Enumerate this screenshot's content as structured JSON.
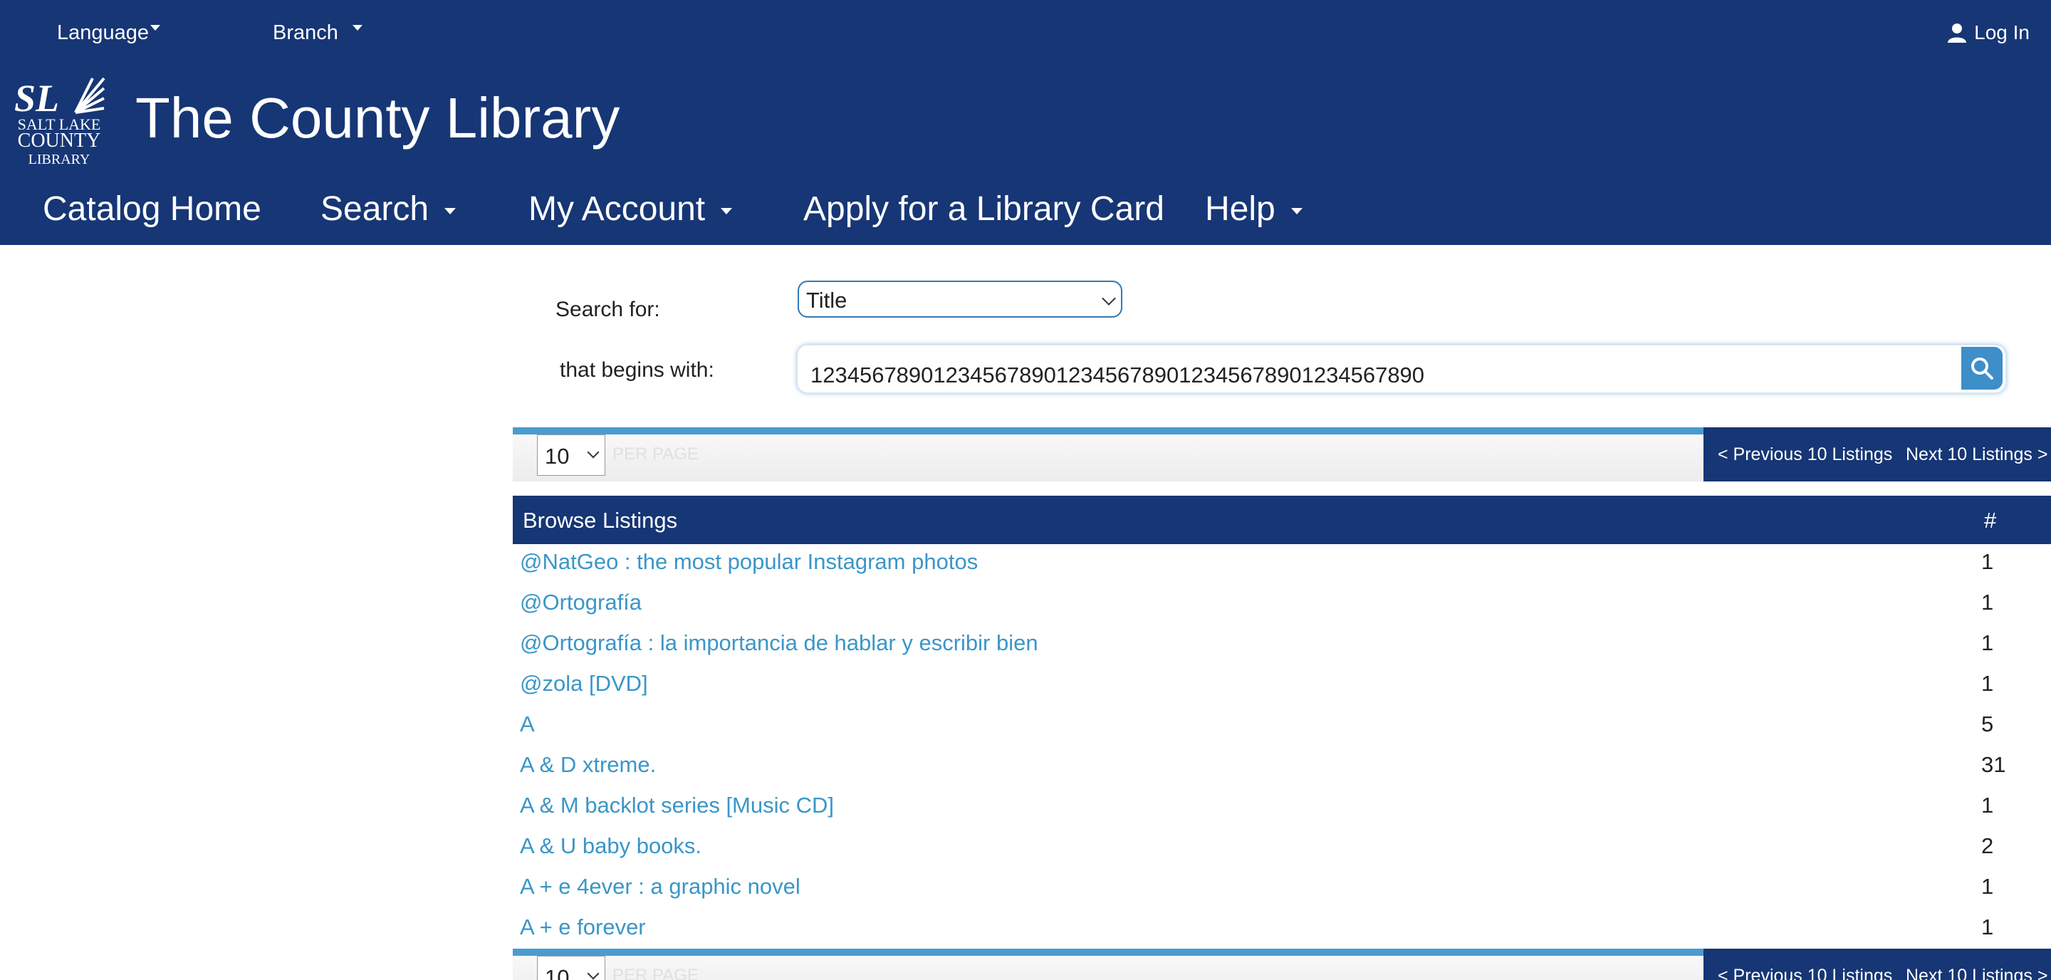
{
  "topbar": {
    "language": "Language",
    "branch": "Branch",
    "login": "Log In"
  },
  "logo": {
    "line1": "SALT LAKE",
    "line2": "COUNTY",
    "line3": "LIBRARY",
    "letters": "SL"
  },
  "site_title": "The County Library",
  "nav": {
    "items": [
      {
        "label": "Catalog Home"
      },
      {
        "label": "Search"
      },
      {
        "label": "My Account"
      },
      {
        "label": "Apply for a Library Card"
      },
      {
        "label": "Help"
      }
    ]
  },
  "search": {
    "search_for_label": "Search for:",
    "search_type": "Title",
    "begins_with_label": "that begins with:",
    "query": "12345678901234567890123456789012345678901234567890"
  },
  "pager": {
    "per_page": "10",
    "per_page_label": "PER PAGE",
    "prev": "< Previous 10 Listings",
    "next": "Next 10 Listings >"
  },
  "browse": {
    "title": "Browse Listings",
    "count_header": "#",
    "rows": [
      {
        "title": "@NatGeo : the most popular Instagram photos",
        "count": "1"
      },
      {
        "title": "@Ortografía",
        "count": "1"
      },
      {
        "title": "@Ortografía : la importancia de hablar y escribir bien",
        "count": "1"
      },
      {
        "title": "@zola [DVD]",
        "count": "1"
      },
      {
        "title": "A",
        "count": "5"
      },
      {
        "title": "A & D xtreme.",
        "count": "31"
      },
      {
        "title": "A & M backlot series [Music CD]",
        "count": "1"
      },
      {
        "title": "A & U baby books.",
        "count": "2"
      },
      {
        "title": "A + e 4ever : a graphic novel",
        "count": "1"
      },
      {
        "title": "A + e forever",
        "count": "1"
      }
    ]
  },
  "colors": {
    "header_bg": "#163675",
    "link": "#3a96c8",
    "accent": "#4a9bd0"
  }
}
